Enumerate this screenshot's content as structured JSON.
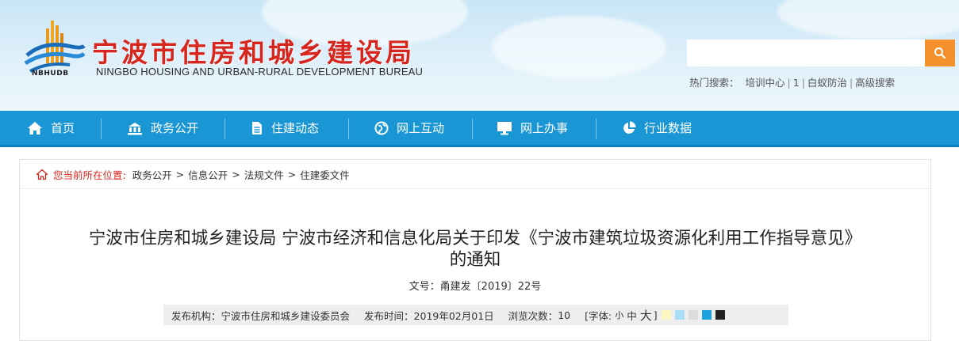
{
  "header": {
    "logo_abbr": "NBHUDB",
    "site_name": "宁波市住房和城乡建设局",
    "site_name_en": "NINGBO HOUSING AND URBAN-RURAL DEVELOPMENT BUREAU",
    "search": {
      "placeholder": "",
      "button_icon": "search-icon"
    },
    "hot_search": {
      "label": "热门搜索：",
      "items": [
        "培训中心",
        "1",
        "白蚁防治",
        "高级搜索"
      ],
      "separator": "|"
    }
  },
  "nav": {
    "items": [
      {
        "label": "首页",
        "icon": "home-icon"
      },
      {
        "label": "政务公开",
        "icon": "government-building-icon"
      },
      {
        "label": "住建动态",
        "icon": "document-icon"
      },
      {
        "label": "网上互动",
        "icon": "globe-icon"
      },
      {
        "label": "网上办事",
        "icon": "monitor-icon"
      },
      {
        "label": "行业数据",
        "icon": "pie-chart-icon"
      }
    ]
  },
  "breadcrumb": {
    "label": "您当前所在位置:",
    "items": [
      "政务公开",
      "信息公开",
      "法规文件",
      "住建委文件"
    ],
    "separator": ">"
  },
  "article": {
    "title_line1": "宁波市住房和城乡建设局 宁波市经济和信息化局关于印发《宁波市建筑垃圾资源化利用工作指导意见》",
    "title_line2": "的通知",
    "doc_no": "文号：甬建发〔2019〕22号"
  },
  "meta": {
    "publisher_label": "发布机构：",
    "publisher": "宁波市住房和城乡建设委员会",
    "date_label": "发布时间：",
    "date": "2019年02月01日",
    "views_label": "浏览次数：",
    "views": "10",
    "font_label": "[字体:",
    "font_small": "小",
    "font_medium": "中",
    "font_large": "大",
    "font_close": "]",
    "theme_colors": [
      "#fdf6c3",
      "#a9ddf5",
      "#dcdcdc",
      "#1aa3e0",
      "#222222"
    ]
  },
  "colors": {
    "brand_red": "#d7261e",
    "nav_blue": "#1a96d4",
    "search_orange": "#f5912c"
  }
}
